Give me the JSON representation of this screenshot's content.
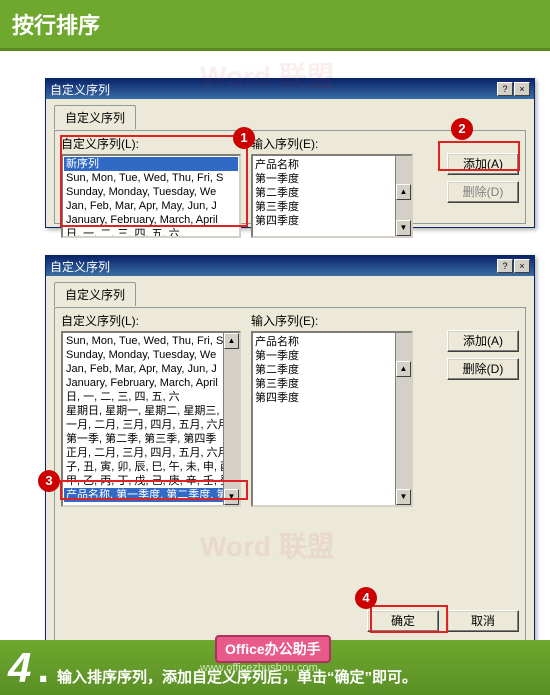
{
  "banner_title": "按行排序",
  "dialog_title": "自定义序列",
  "tab_label": "自定义序列",
  "left_label": "自定义序列(L):",
  "right_label": "输入序列(E):",
  "btn_add": "添加(A)",
  "btn_del": "删除(D)",
  "btn_ok": "确定",
  "btn_cancel": "取消",
  "help_btn": "?",
  "close_btn": "×",
  "list1": {
    "selected": "新序列",
    "items": [
      "Sun, Mon, Tue, Wed, Thu, Fri, S",
      "Sunday, Monday, Tuesday, We",
      "Jan, Feb, Mar, Apr, May, Jun, J",
      "January, February, March, April",
      "日, 一, 二, 三, 四, 五, 六"
    ]
  },
  "entries1": "产品名称\n第一季度\n第二季度\n第三季度\n第四季度",
  "list2": {
    "items": [
      "Sun, Mon, Tue, Wed, Thu, Fri, S",
      "Sunday, Monday, Tuesday, We",
      "Jan, Feb, Mar, Apr, May, Jun, J",
      "January, February, March, April",
      "日, 一, 二, 三, 四, 五, 六",
      "星期日, 星期一, 星期二, 星期三,",
      "一月, 二月, 三月, 四月, 五月, 六月",
      "第一季, 第二季, 第三季, 第四季",
      "正月, 二月, 三月, 四月, 五月, 六月",
      "子, 丑, 寅, 卯, 辰, 巳, 午, 未, 申, 酉",
      "甲, 乙, 丙, 丁, 戊, 己, 庚, 辛, 壬, 癸"
    ],
    "selected": "产品名称, 第一季度, 第二季度, 第"
  },
  "entries2": "产品名称\n第一季度\n第二季度\n第三季度\n第四季度",
  "badges": {
    "b1": "1",
    "b2": "2",
    "b3": "3",
    "b4": "4"
  },
  "bottom": {
    "step": "4",
    "pink": "Office办公助手",
    "url": "www.officezhushou.com",
    "instr": "输入排序序列，添加自定义序列后，单击“确定”即可。"
  },
  "watermark": "Word 联盟"
}
